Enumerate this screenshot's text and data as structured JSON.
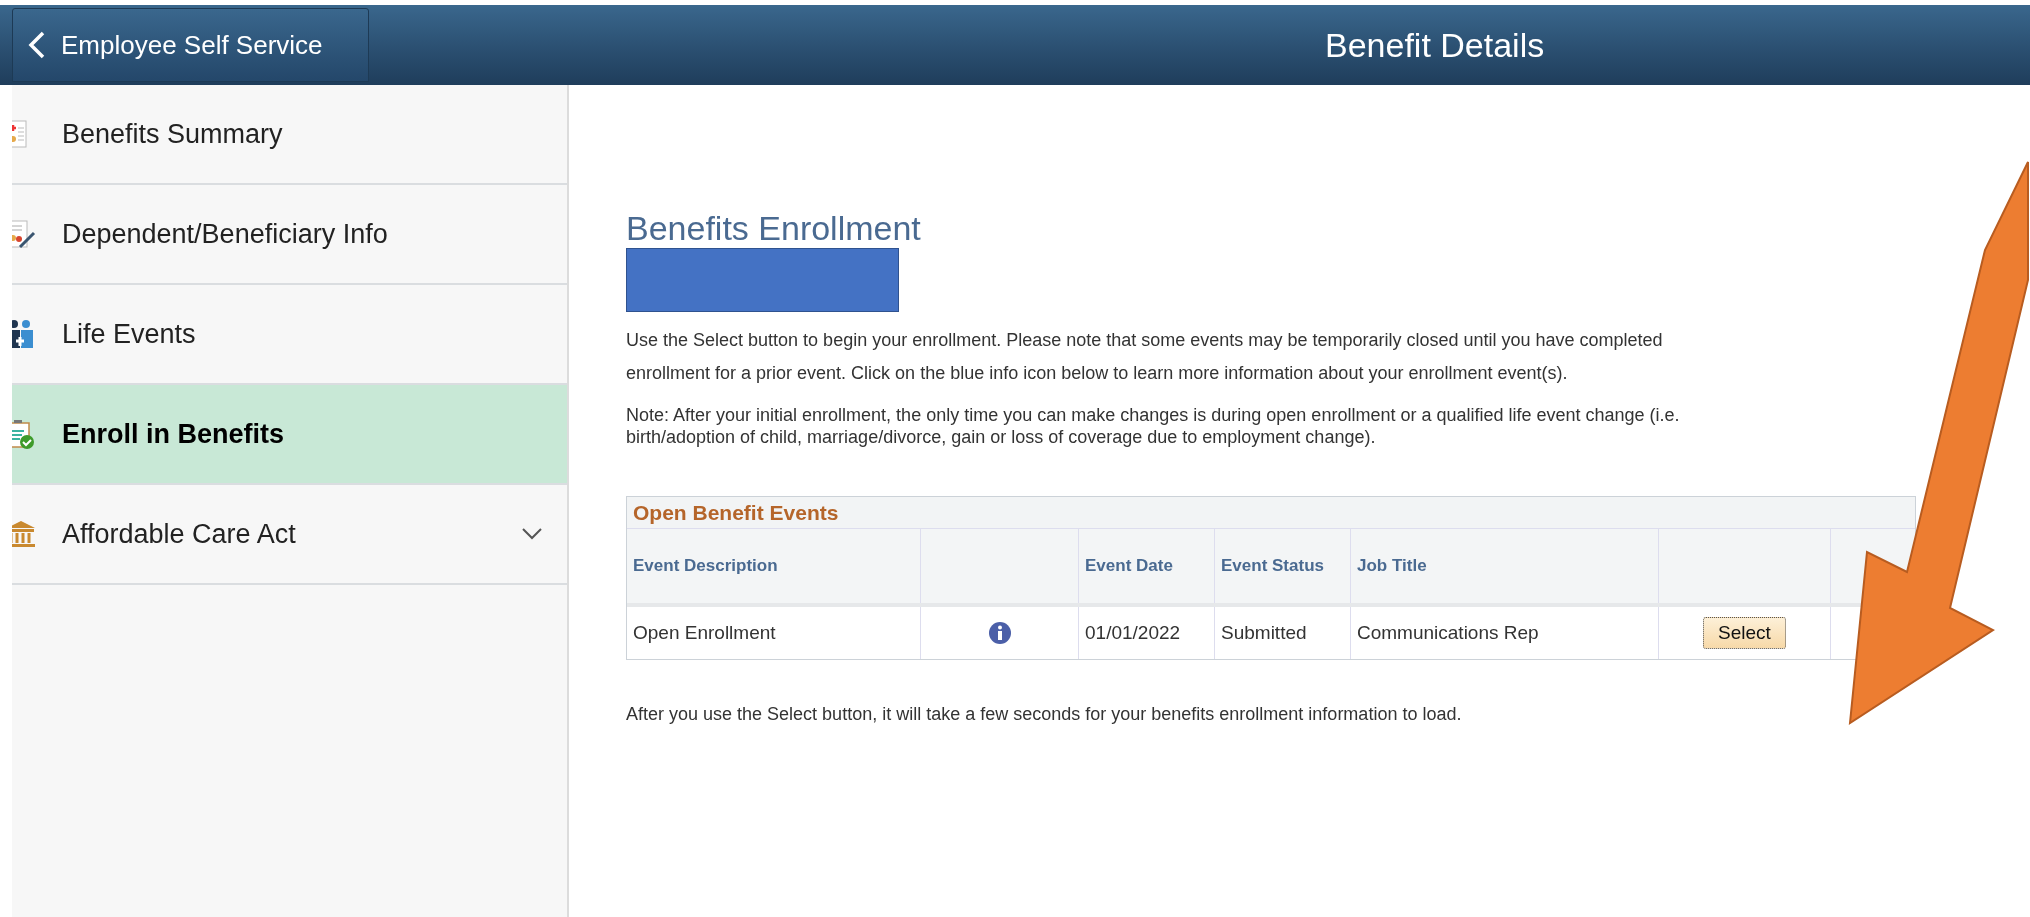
{
  "header": {
    "back_label": "Employee Self Service",
    "title": "Benefit Details"
  },
  "sidebar": {
    "items": [
      {
        "label": "Benefits Summary",
        "kind": "summary",
        "selected": false
      },
      {
        "label": "Dependent/Beneficiary Info",
        "kind": "dependent",
        "selected": false
      },
      {
        "label": "Life Events",
        "kind": "life",
        "selected": false
      },
      {
        "label": "Enroll in Benefits",
        "kind": "enroll",
        "selected": true
      },
      {
        "label": "Affordable Care Act",
        "kind": "aca",
        "selected": false,
        "expanded": false
      }
    ]
  },
  "content": {
    "heading": "Benefits Enrollment",
    "intro": "Use the Select button to begin your enrollment. Please note that some events may be temporarily closed until you have completed enrollment for a prior event. Click on the blue info icon below to learn more information about your enrollment event(s).",
    "note": "Note: After your initial enrollment, the only time you can make changes is during open enrollment or a qualified life event change (i.e. birth/adoption of child, marriage/divorce, gain or loss of coverage due to employment change).",
    "table": {
      "title": "Open Benefit Events",
      "columns": [
        "Event Description",
        "Event Date",
        "Event Status",
        "Job Title"
      ],
      "rows": [
        {
          "description": "Open Enrollment",
          "date": "01/01/2022",
          "status": "Submitted",
          "job_title": "Communications Rep",
          "action": "Select"
        }
      ]
    },
    "footer_text": "After you use the Select button, it will take a few seconds for your benefits enrollment information to load."
  }
}
